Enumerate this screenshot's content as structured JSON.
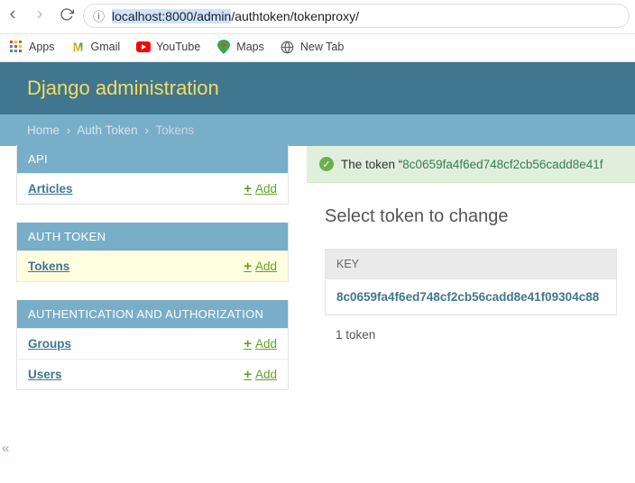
{
  "browser": {
    "url_selected": "localhost:8000/admin",
    "url_rest": "/authtoken/tokenproxy/",
    "bookmarks": {
      "apps": "Apps",
      "gmail": "Gmail",
      "youtube": "YouTube",
      "maps": "Maps",
      "newtab": "New Tab"
    }
  },
  "header": {
    "title": "Django administration"
  },
  "breadcrumb": {
    "home": "Home",
    "section": "Auth Token",
    "current": "Tokens"
  },
  "sidebar": {
    "add_label": "Add",
    "panels": [
      {
        "caption": "API",
        "rows": [
          {
            "model": "Articles"
          }
        ]
      },
      {
        "caption": "AUTH TOKEN",
        "rows": [
          {
            "model": "Tokens",
            "highlight": true
          }
        ]
      },
      {
        "caption": "AUTHENTICATION AND AUTHORIZATION",
        "rows": [
          {
            "model": "Groups"
          },
          {
            "model": "Users"
          }
        ]
      }
    ]
  },
  "message": {
    "prefix": "The token “",
    "token": "8c0659fa4f6ed748cf2cb56cadd8e41f"
  },
  "main": {
    "heading": "Select token to change",
    "col_key": "KEY",
    "row_token": "8c0659fa4f6ed748cf2cb56cadd8e41f09304c88",
    "count": "1 token"
  }
}
